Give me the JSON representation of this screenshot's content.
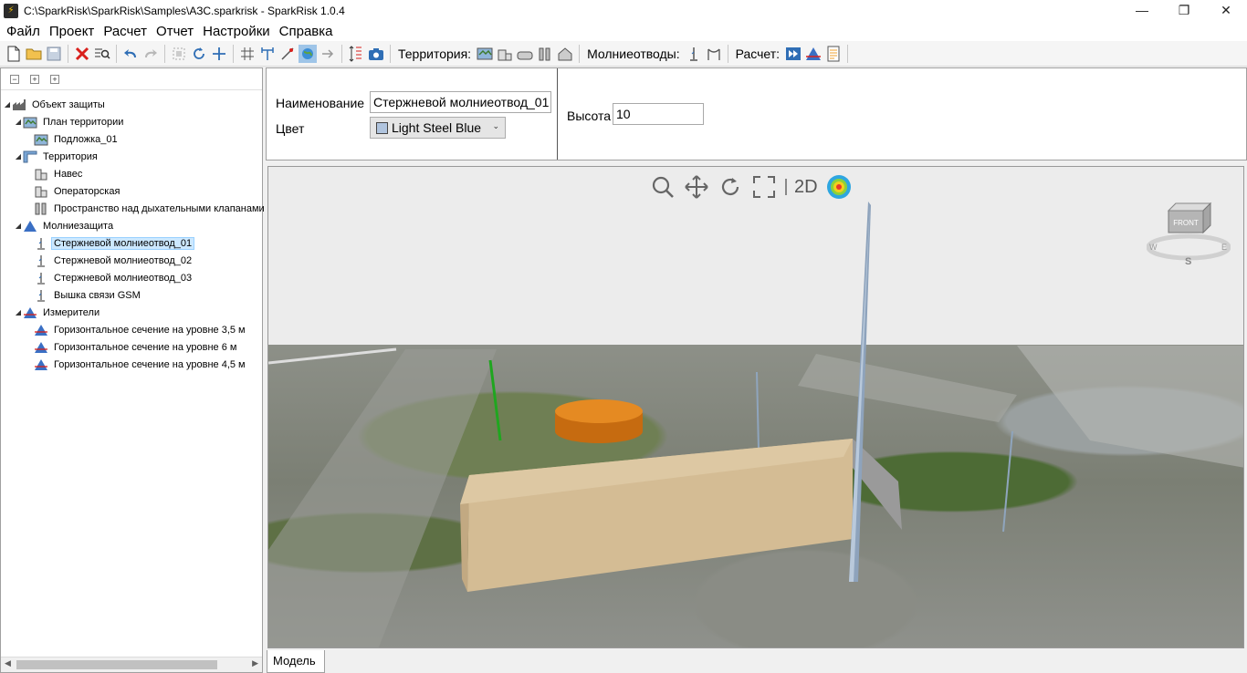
{
  "window": {
    "title": "C:\\SparkRisk\\SparkRisk\\Samples\\АЗС.sparkrisk - SparkRisk 1.0.4",
    "minimize": "—",
    "restore": "❐",
    "close": "✕"
  },
  "menu": [
    "Файл",
    "Проект",
    "Расчет",
    "Отчет",
    "Настройки",
    "Справка"
  ],
  "toolbar": {
    "territory_label": "Территория:",
    "rods_label": "Молниеотводы:",
    "calc_label": "Расчет:"
  },
  "tree": {
    "root": "Объект защиты",
    "plan": "План территории",
    "plan_children": [
      "Подложка_01"
    ],
    "territory": "Территория",
    "territory_children": [
      "Навес",
      "Операторская",
      "Пространство над дыхательными клапанами"
    ],
    "protection": "Молниезащита",
    "protection_children": [
      "Стержневой молниеотвод_01",
      "Стержневой молниеотвод_02",
      "Стержневой молниеотвод_03",
      "Вышка связи GSM"
    ],
    "meters": "Измерители",
    "meters_children": [
      "Горизонтальное сечение на уровне 3,5 м",
      "Горизонтальное сечение на уровне 6 м",
      "Горизонтальное сечение на уровне 4,5 м"
    ]
  },
  "props": {
    "name_label": "Наименование",
    "name_value": "Стержневой молниеотвод_01",
    "color_label": "Цвет",
    "color_value": "Light Steel Blue",
    "height_label": "Высота",
    "height_value": "10"
  },
  "viewport": {
    "mode_2d": "2D",
    "cube_front": "FRONT",
    "compass_w": "W",
    "compass_e": "E",
    "compass_s": "S"
  },
  "tabs": {
    "model": "Модель"
  },
  "colors": {
    "selected_rod": "#b0c4de",
    "tank": "#d57a14",
    "building": "#d4bc94",
    "tree_selection": "#cce8ff"
  }
}
